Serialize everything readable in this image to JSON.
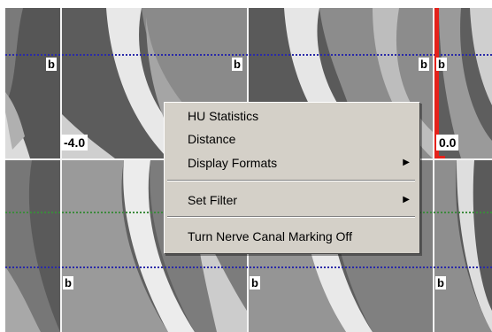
{
  "viewer": {
    "marker_letter": "b",
    "position_left": "-4.0",
    "position_right": "0.0"
  },
  "context_menu": {
    "items": [
      {
        "label": "HU Statistics",
        "submenu": false
      },
      {
        "label": "Distance",
        "submenu": false
      },
      {
        "label": "Display Formats",
        "submenu": true
      },
      {
        "label": "Set Filter",
        "submenu": true
      },
      {
        "label": "Turn Nerve Canal Marking Off",
        "submenu": false
      }
    ],
    "submenu_arrow": "▶"
  },
  "colors": {
    "menu_bg": "#d4d0c8",
    "nerve_canal_marker": "#e4221b",
    "guide_line_blue": "#2a2aa8",
    "guide_line_green": "#3d8a3d"
  }
}
